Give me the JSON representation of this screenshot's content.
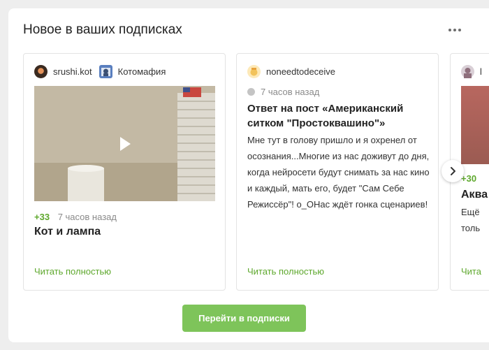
{
  "section": {
    "title": "Новое в ваших подписках",
    "more_icon": "more-dots-icon",
    "go_button": "Перейти в подписки",
    "next_icon": "chevron-right-icon"
  },
  "cards": [
    {
      "author": "srushi.kot",
      "community": "Котомафия",
      "rating": "+33",
      "time": "7 часов назад",
      "title": "Кот и лампа",
      "read_more": "Читать полностью",
      "media": "video",
      "play_icon": "play-icon"
    },
    {
      "author": "noneedtodeceive",
      "time": "7 часов назад",
      "title": "Ответ на пост «Американский ситком \"Простоквашино\"»",
      "body": "Мне тут в голову пришло и я охренел от осознания...Многие из нас доживут до дня, когда нейросети будут снимать за нас кино и каждый, мать его, будет \"Сам Себе Режиссёр\"!  о_ОНас ждёт гонка сценариев!",
      "read_more": "Читать полностью"
    },
    {
      "author": "l",
      "rating": "+30",
      "title": "Аква",
      "line1": "Ещё",
      "line2": "толь",
      "read_more": "Чита"
    }
  ],
  "colors": {
    "accent_green": "#5ea82d",
    "button_green": "#7ec45a",
    "page_bg": "#eeeeee"
  }
}
